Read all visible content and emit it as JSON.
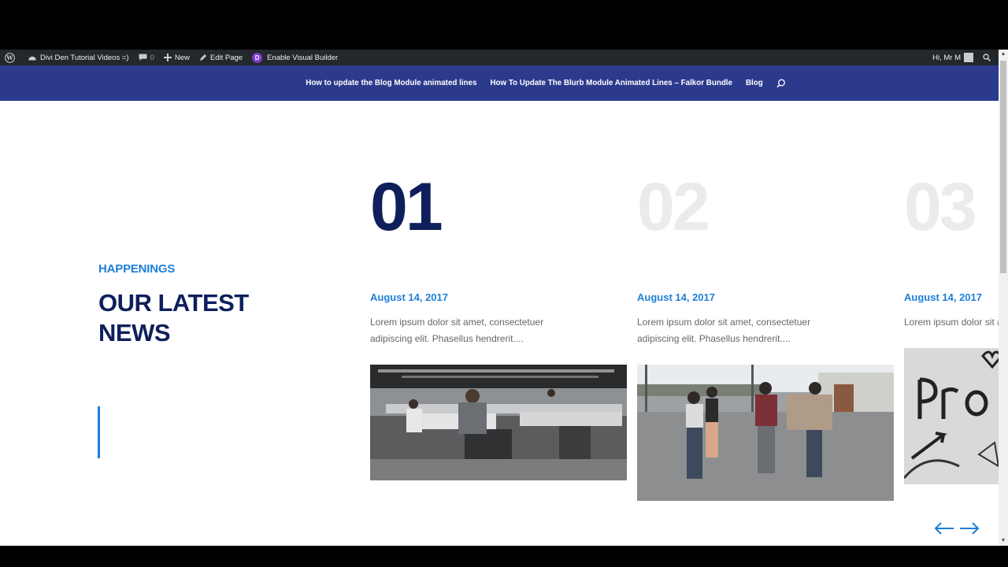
{
  "adminbar": {
    "site_name": "Divi Den Tutorial Videos =)",
    "comments_count": "0",
    "new_label": "New",
    "edit_label": "Edit Page",
    "builder_label": "Enable Visual Builder",
    "divi_letter": "D",
    "greeting": "Hi, Mr M"
  },
  "nav": {
    "items": [
      "How to update the Blog Module animated lines",
      "How To Update The Blurb Module Animated Lines – Falkor Bundle",
      "Blog"
    ]
  },
  "section": {
    "eyebrow": "HAPPENINGS",
    "heading": "OUR LATEST NEWS"
  },
  "posts": [
    {
      "num": "01",
      "date": "August 14, 2017",
      "excerpt": "Lorem ipsum dolor sit amet, consectetuer adipiscing elit. Phasellus hendrerit...."
    },
    {
      "num": "02",
      "date": "August 14, 2017",
      "excerpt": "Lorem ipsum dolor sit amet, consectetuer adipiscing elit. Phasellus hendrerit...."
    },
    {
      "num": "03",
      "date": "August 14, 2017",
      "excerpt": "Lorem ipsum dolor sit amet, consectetuer adipiscing elit. Phasellus hendrerit...."
    }
  ],
  "colors": {
    "header_bg": "#2c3a8c",
    "accent": "#1e7fd6",
    "heading": "#0e1f5b"
  }
}
